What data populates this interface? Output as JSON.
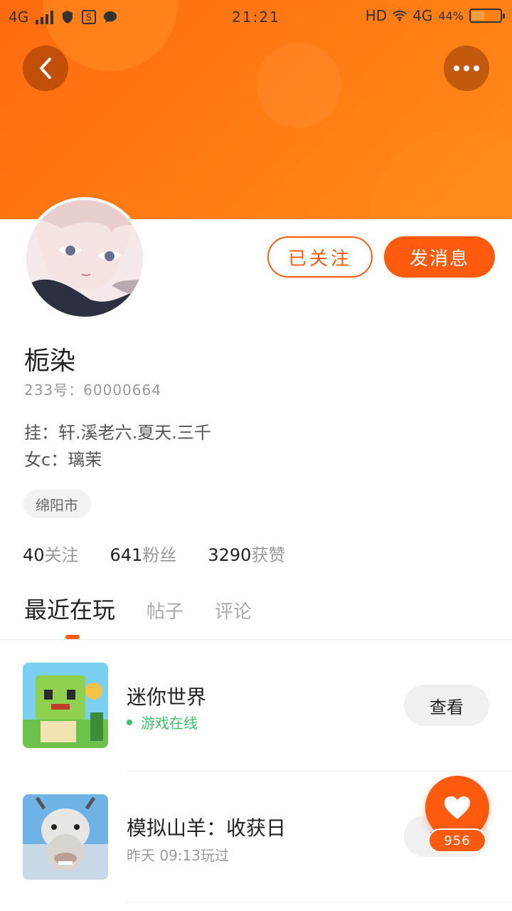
{
  "statusbar": {
    "network_left": "4G",
    "time": "21:21",
    "hd": "HD",
    "network_right": "4G",
    "battery": "44%",
    "battery_level": 0.44
  },
  "profile": {
    "name": "栀染",
    "uid": "233号：60000664",
    "bio_line1": "挂：轩.溪老六.夏天.三千",
    "bio_line2": "女c：璃茉",
    "location": "绵阳市",
    "follow_button": "已关注",
    "message_button": "发消息"
  },
  "stats": [
    {
      "num": "40",
      "label": "关注"
    },
    {
      "num": "641",
      "label": "粉丝"
    },
    {
      "num": "3290",
      "label": "获赞"
    }
  ],
  "tabs": [
    {
      "label": "最近在玩"
    },
    {
      "label": "帖子"
    },
    {
      "label": "评论"
    }
  ],
  "games": [
    {
      "title": "迷你世界",
      "status": "游戏在线",
      "button": "查看"
    },
    {
      "title": "模拟山羊：收获日",
      "sub": "昨天 09:13玩过",
      "button": "查看"
    }
  ],
  "like": {
    "count": "956"
  },
  "colors": {
    "accent": "#ff5a0e",
    "online": "#3bc36a",
    "header": "#ff7a12"
  }
}
